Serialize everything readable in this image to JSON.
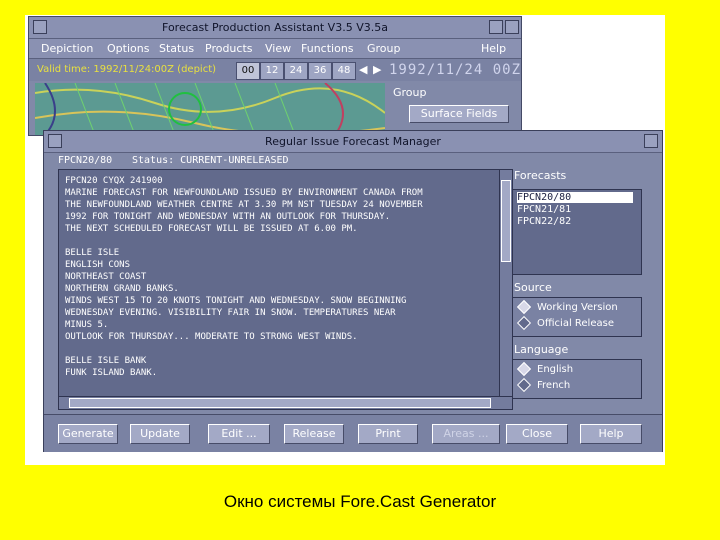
{
  "background_window": {
    "title": "Forecast Production Assistant V3.5 V3.5a",
    "menu": [
      "Depiction",
      "Options",
      "Status",
      "Products",
      "View",
      "Functions",
      "Group",
      "Help"
    ],
    "valid_time": "Valid time: 1992/11/24:00Z (depict)",
    "hour_buttons": [
      "00",
      "12",
      "24",
      "36",
      "48"
    ],
    "date": "1992/11/24 00Z",
    "group_label": "Group",
    "group_button": "Surface Fields"
  },
  "main_window": {
    "title": "Regular Issue Forecast Manager",
    "product_id": "FPCN20/80",
    "status": "Status: CURRENT-UNRELEASED",
    "forecast_text": [
      "FPCN20 CYQX 241900",
      "MARINE FORECAST FOR NEWFOUNDLAND ISSUED BY ENVIRONMENT CANADA FROM",
      "THE NEWFOUNDLAND WEATHER CENTRE AT 3.30 PM NST TUESDAY 24 NOVEMBER",
      "1992 FOR TONIGHT AND WEDNESDAY WITH AN OUTLOOK FOR THURSDAY.",
      "THE NEXT SCHEDULED FORECAST WILL BE ISSUED AT 6.00 PM.",
      "",
      "BELLE ISLE",
      "ENGLISH CONS",
      "NORTHEAST COAST",
      "NORTHERN GRAND BANKS.",
      "WINDS WEST 15 TO 20 KNOTS TONIGHT AND WEDNESDAY. SNOW BEGINNING",
      "WEDNESDAY EVENING. VISIBILITY FAIR IN SNOW. TEMPERATURES NEAR",
      "MINUS 5.",
      "OUTLOOK FOR THURSDAY... MODERATE TO STRONG WEST WINDS.",
      "",
      "BELLE ISLE BANK",
      "FUNK ISLAND BANK."
    ],
    "forecasts_label": "Forecasts",
    "forecasts": [
      "FPCN20/80",
      "FPCN21/81",
      "FPCN22/82"
    ],
    "source_label": "Source",
    "source_options": [
      "Working Version",
      "Official Release"
    ],
    "language_label": "Language",
    "language_options": [
      "English",
      "French"
    ],
    "buttons": [
      "Generate",
      "Update",
      "Edit ...",
      "Release",
      "Print",
      "Areas ...",
      "Close",
      "Help"
    ]
  },
  "caption": "Окно системы Fore.Cast Generator",
  "colors": {
    "page_background": "#ffff00",
    "window": "#8189a8",
    "text_area": "#626a8c"
  }
}
